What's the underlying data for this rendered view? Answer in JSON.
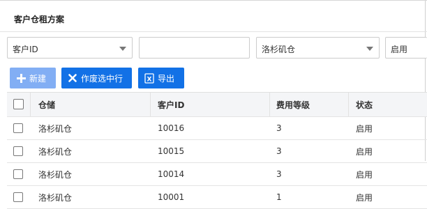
{
  "panel": {
    "title": "客户仓租方案"
  },
  "filters": {
    "field1": {
      "value": "客户ID"
    },
    "field2": {
      "value": ""
    },
    "field3": {
      "value": "洛杉矶仓"
    },
    "field4": {
      "value": "启用"
    }
  },
  "toolbar": {
    "new_label": "新建",
    "void_label": "作废选中行",
    "export_label": "导出",
    "icons": {
      "new": "plus-icon",
      "void": "x-icon",
      "export": "excel-icon"
    },
    "colors": {
      "primary": "#1271e6",
      "disabled": "#82aef4"
    }
  },
  "table": {
    "columns": [
      "仓储",
      "客户ID",
      "费用等级",
      "状态"
    ],
    "rows": [
      {
        "warehouse": "洛杉矶仓",
        "customer_id": "10016",
        "fee_level": "3",
        "status": "启用"
      },
      {
        "warehouse": "洛杉矶仓",
        "customer_id": "10015",
        "fee_level": "3",
        "status": "启用"
      },
      {
        "warehouse": "洛杉矶仓",
        "customer_id": "10014",
        "fee_level": "3",
        "status": "启用"
      },
      {
        "warehouse": "洛杉矶仓",
        "customer_id": "10001",
        "fee_level": "1",
        "status": "启用"
      }
    ]
  }
}
